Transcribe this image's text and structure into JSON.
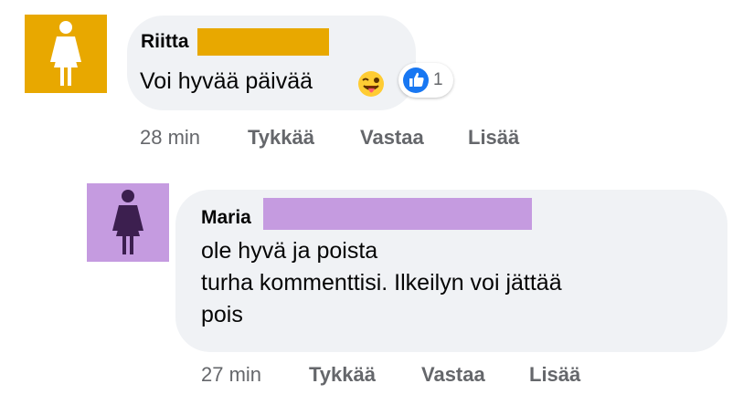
{
  "comments": [
    {
      "author": "Riitta",
      "text_lines": [
        "Voi hyvää päivää"
      ],
      "emoji": "winking-face-tongue",
      "reaction": {
        "icon": "thumbs-up-icon",
        "count": "1"
      },
      "time": "28 min",
      "actions": [
        "Tykkää",
        "Vastaa",
        "Lisää"
      ],
      "avatar_color": "#e8a800",
      "redaction_color": "#e8a800"
    },
    {
      "author": "Maria",
      "text_lines": [
        "ole hyvä ja poista",
        "turha kommenttisi. Ilkeilyn voi jättää",
        "pois"
      ],
      "time": "27 min",
      "actions": [
        "Tykkää",
        "Vastaa",
        "Lisää"
      ],
      "avatar_color": "#c59be0",
      "redaction_color": "#c59be0"
    }
  ],
  "colors": {
    "bubble": "#f0f2f5",
    "meta_text": "#65676b",
    "like_blue": "#1877f2"
  }
}
